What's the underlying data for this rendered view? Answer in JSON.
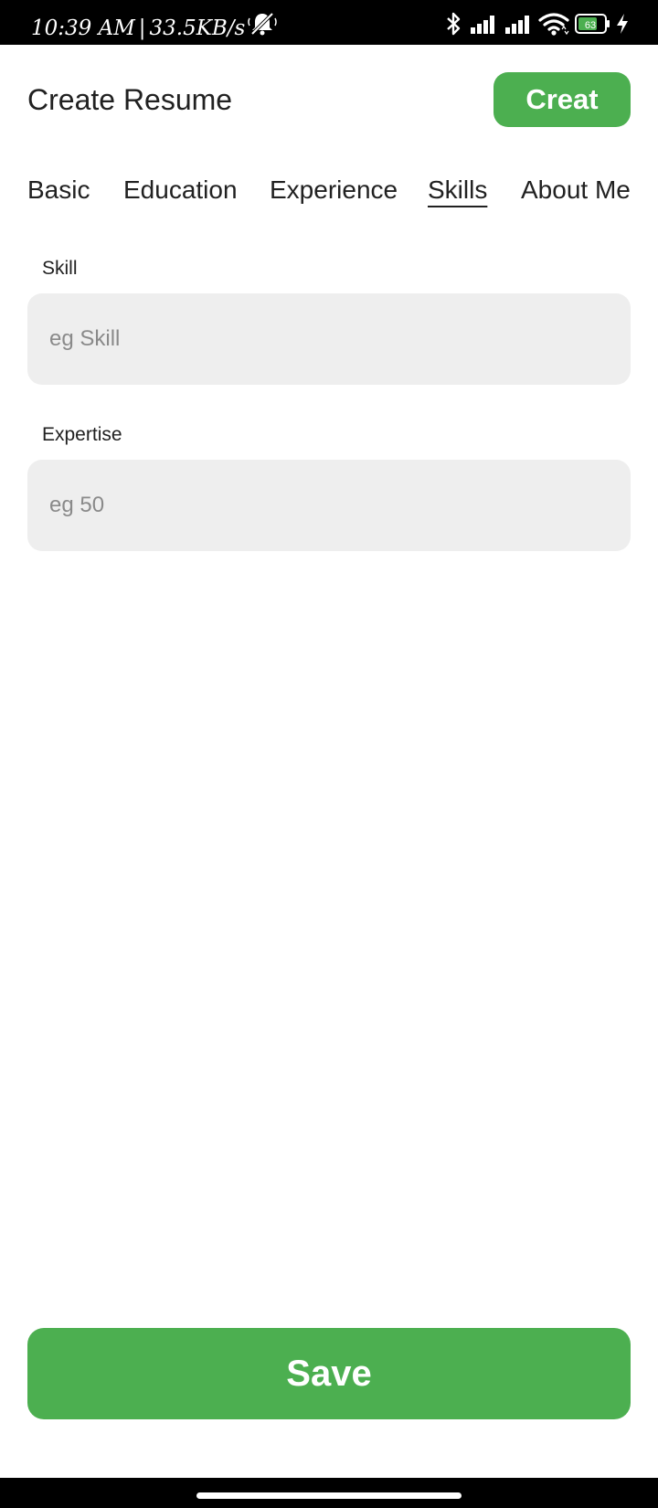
{
  "status_bar": {
    "time": "10:39 AM",
    "separator": "|",
    "network_speed": "33.5KB/s",
    "battery_level": "63",
    "icons": [
      "mute-icon",
      "bluetooth-icon",
      "signal-icon",
      "signal-icon",
      "wifi-icon",
      "battery-icon",
      "charging-icon"
    ]
  },
  "header": {
    "title": "Create Resume",
    "create_label": "Creat"
  },
  "tabs": [
    {
      "label": "Basic",
      "active": false
    },
    {
      "label": "Education",
      "active": false
    },
    {
      "label": "Experience",
      "active": false
    },
    {
      "label": "Skills",
      "active": true
    },
    {
      "label": "About Me",
      "active": false
    }
  ],
  "form": {
    "skill": {
      "label": "Skill",
      "value": "",
      "placeholder": "eg Skill"
    },
    "expertise": {
      "label": "Expertise",
      "value": "",
      "placeholder": "eg 50"
    }
  },
  "footer": {
    "save_label": "Save"
  },
  "colors": {
    "accent": "#4caf50",
    "input_bg": "#eeeeee",
    "text": "#212121",
    "placeholder": "#8a8a8a"
  }
}
